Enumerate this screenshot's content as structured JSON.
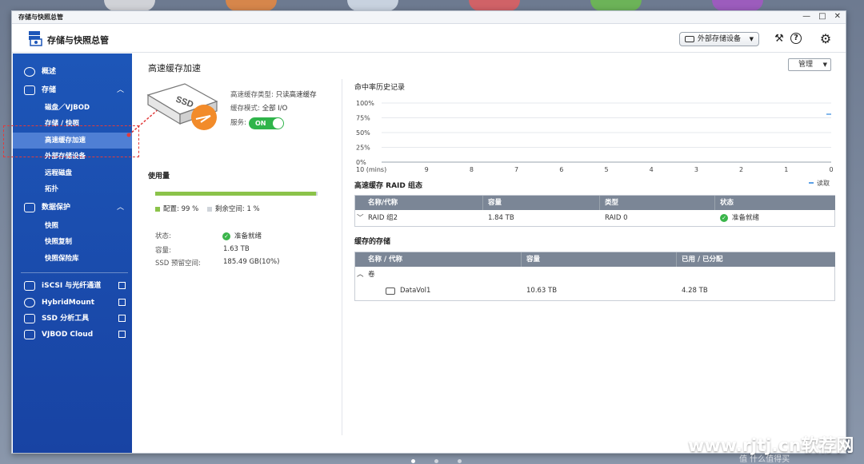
{
  "window": {
    "title": "存储与快照总管"
  },
  "header": {
    "app_title": "存储与快照总管",
    "external_storage_label": "外部存储设备"
  },
  "sidebar": {
    "overview": "概述",
    "storage": "存储",
    "storage_items": [
      "磁盘／VJBOD",
      "存储 / 快照",
      "高速缓存加速",
      "外部存储设备",
      "远程磁盘",
      "拓扑"
    ],
    "data_protection": "数据保护",
    "protection_items": [
      "快照",
      "快照复制",
      "快照保险库"
    ],
    "links": [
      "iSCSI 与光纤通道",
      "HybridMount",
      "SSD 分析工具",
      "VJBOD Cloud"
    ]
  },
  "main": {
    "title": "高速缓存加速",
    "manage_label": "管理",
    "cache_type_key": "高速缓存类型:",
    "cache_type_val": "只读高速缓存",
    "cache_mode_key": "缓存模式:",
    "cache_mode_val": "全部 I/O",
    "service_key": "服务:",
    "service_state": "ON",
    "ssd_label": "SSD",
    "usage_title": "使用量",
    "usage_fraction": 0.99,
    "legend_alloc": "配置: 99 %",
    "legend_free": "剩余空间: 1 %",
    "status_key": "状态:",
    "status_val": "准备就绪",
    "capacity_key": "容量:",
    "capacity_val": "1.63 TB",
    "reserved_key": "SSD 预留空间:",
    "reserved_val": "185.49 GB(10%)"
  },
  "chart_data": {
    "type": "line",
    "title": "命中率历史记录",
    "xlabel": "",
    "ylabel": "",
    "y_ticks": [
      "100%",
      "75%",
      "50%",
      "25%",
      "0%"
    ],
    "x_ticks": [
      "10 (mins)",
      "9",
      "8",
      "7",
      "6",
      "5",
      "4",
      "3",
      "2",
      "1",
      "0"
    ],
    "ylim": [
      0,
      100
    ],
    "series": [
      {
        "name": "读取",
        "values": []
      }
    ],
    "legend_position": "bottom-right"
  },
  "raid_table": {
    "title": "高速缓存 RAID 组态",
    "headers": [
      "名称/代称",
      "容量",
      "类型",
      "状态"
    ],
    "rows": [
      {
        "name": "RAID 组2",
        "capacity": "1.84 TB",
        "type": "RAID 0",
        "status": "准备就绪"
      }
    ]
  },
  "storage_table": {
    "title": "缓存的存储",
    "headers": [
      "名称 / 代称",
      "容量",
      "已用 / 已分配"
    ],
    "group_label": "卷",
    "rows": [
      {
        "name": "DataVol1",
        "capacity": "10.63 TB",
        "used": "4.28 TB"
      }
    ]
  },
  "watermark": {
    "main": "www.rjtj.cn软荐网",
    "sub": "值 什么值得买"
  },
  "colors": {
    "sidebar": "#1d56b8",
    "accent_green": "#3ab54a",
    "usage_bar": "#8bc34a",
    "table_header": "#7b8696"
  }
}
